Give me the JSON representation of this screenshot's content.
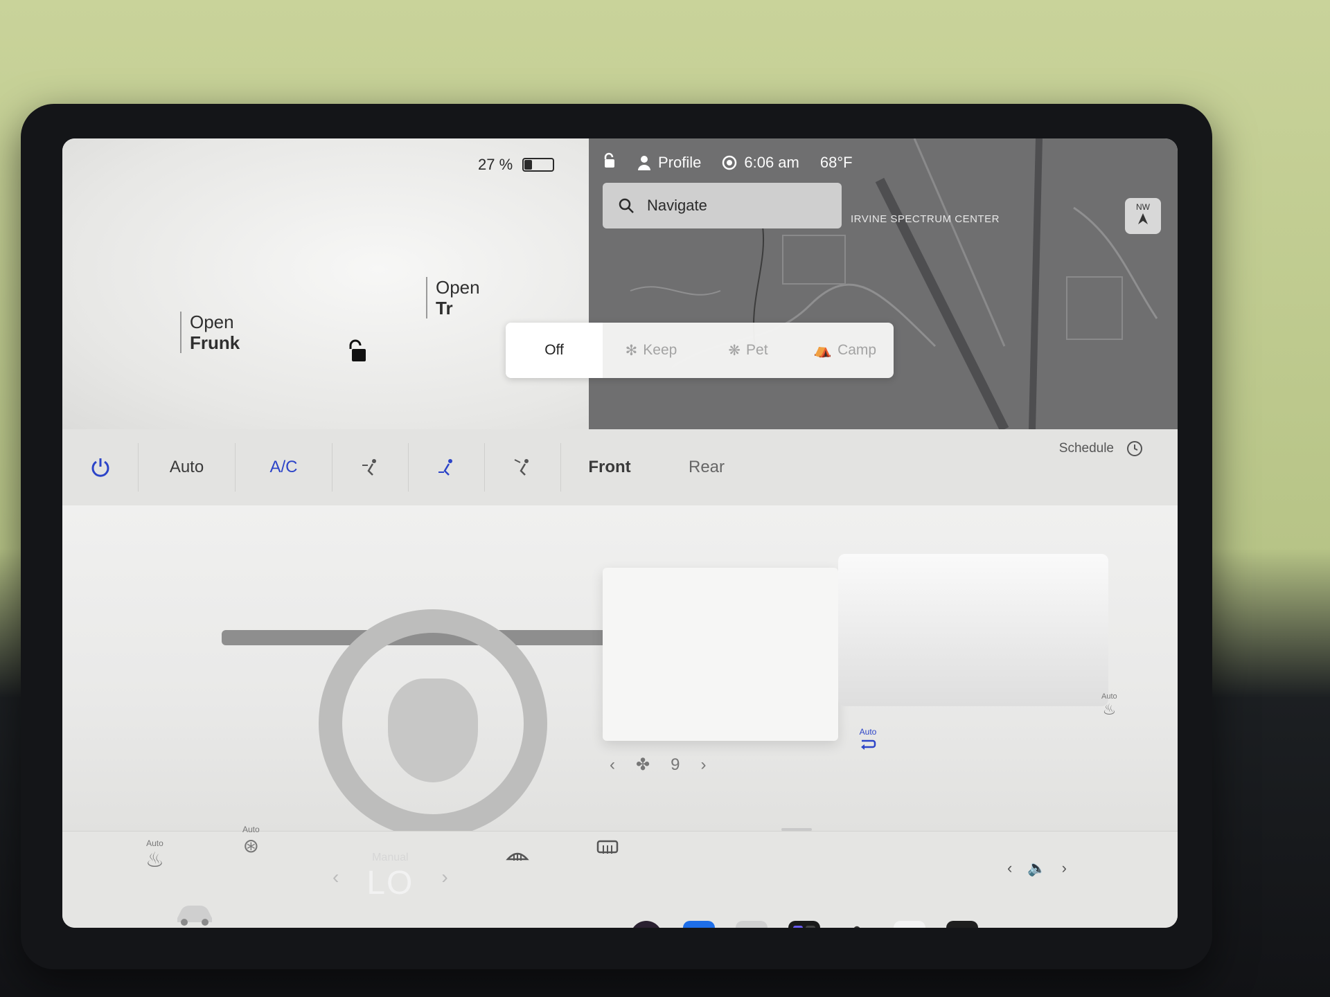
{
  "status": {
    "battery_percent_text": "27 %",
    "battery_level": 0.27
  },
  "trunk": {
    "frunk_label_line1": "Open",
    "frunk_label_line2": "Frunk",
    "trunk_label_line1": "Open",
    "trunk_label_line2": "Tr"
  },
  "map": {
    "profile_label": "Profile",
    "time": "6:06 am",
    "temperature": "68°F",
    "navigate_placeholder": "Navigate",
    "place_label": "IRVINE SPECTRUM CENTER",
    "compass_heading": "NW"
  },
  "keeper_modes": [
    {
      "label": "Off",
      "active": true
    },
    {
      "label": "Keep",
      "active": false
    },
    {
      "label": "Pet",
      "active": false
    },
    {
      "label": "Camp",
      "active": false
    }
  ],
  "climate": {
    "auto_label": "Auto",
    "ac_label": "A/C",
    "front_label": "Front",
    "rear_label": "Rear",
    "schedule_label": "Schedule",
    "fan_speed": "9",
    "rear_auto_label": "Auto",
    "seat_auto_label": "Auto",
    "driver_seat_auto_label": "Auto",
    "wheel_heat_auto_label": "Auto",
    "accent_color": "#2c44c8"
  },
  "dock": {
    "temp_mode_label": "Manual",
    "temp_value": "LO",
    "apps": [
      "camera-icon",
      "bluetooth-icon",
      "manual-icon",
      "app-launcher-icon",
      "fan-icon",
      "notepad-icon",
      "toybox-icon"
    ]
  }
}
